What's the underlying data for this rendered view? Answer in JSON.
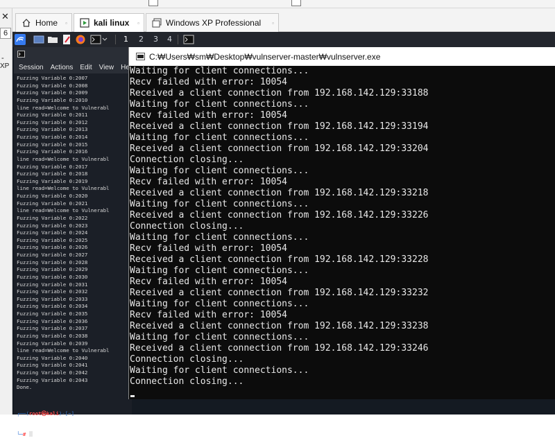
{
  "host": {
    "close_glyph": "✕",
    "field_value": "6",
    "dash": "-",
    "side_label": "XP"
  },
  "tabs": [
    {
      "label": "Home",
      "icon": "home-icon"
    },
    {
      "label": "kali linux",
      "icon": "vm-play-icon"
    },
    {
      "label": "Windows XP Professional",
      "icon": "vm-icon"
    }
  ],
  "kali_panel": {
    "workspaces": [
      "1",
      "2",
      "3",
      "4"
    ],
    "accent": "#367bf0"
  },
  "kali_terminal": {
    "menu": [
      "Session",
      "Actions",
      "Edit",
      "View",
      "He"
    ],
    "lines": [
      "Fuzzing Variable 0:2007",
      "Fuzzing Variable 0:2008",
      "Fuzzing Variable 0:2009",
      "Fuzzing Variable 0:2010",
      "line read=Welcome to Vulnerabl",
      "Fuzzing Variable 0:2011",
      "Fuzzing Variable 0:2012",
      "Fuzzing Variable 0:2013",
      "Fuzzing Variable 0:2014",
      "Fuzzing Variable 0:2015",
      "Fuzzing Variable 0:2016",
      "line read=Welcome to Vulnerabl",
      "Fuzzing Variable 0:2017",
      "Fuzzing Variable 0:2018",
      "Fuzzing Variable 0:2019",
      "line read=Welcome to Vulnerabl",
      "Fuzzing Variable 0:2020",
      "Fuzzing Variable 0:2021",
      "line read=Welcome to Vulnerabl",
      "Fuzzing Variable 0:2022",
      "Fuzzing Variable 0:2023",
      "Fuzzing Variable 0:2024",
      "Fuzzing Variable 0:2025",
      "Fuzzing Variable 0:2026",
      "Fuzzing Variable 0:2027",
      "Fuzzing Variable 0:2028",
      "Fuzzing Variable 0:2029",
      "Fuzzing Variable 0:2030",
      "Fuzzing Variable 0:2031",
      "Fuzzing Variable 0:2032",
      "Fuzzing Variable 0:2033",
      "Fuzzing Variable 0:2034",
      "Fuzzing Variable 0:2035",
      "Fuzzing Variable 0:2036",
      "Fuzzing Variable 0:2037",
      "Fuzzing Variable 0:2038",
      "Fuzzing Variable 0:2039",
      "line read=Welcome to Vulnerabl",
      "Fuzzing Variable 0:2040",
      "Fuzzing Variable 0:2041",
      "Fuzzing Variable 0:2042",
      "Fuzzing Variable 0:2043",
      "Done."
    ],
    "prompt_open": "┌──(",
    "prompt_user": "root㉿kali",
    "prompt_close": ")-[~]",
    "prompt_line2": "└─",
    "prompt_symbol": "#"
  },
  "cmd_window": {
    "title": "C:₩Users₩sm₩Desktop₩vulnserver-master₩vulnserver.exe",
    "lines": [
      "Waiting for client connections...",
      "Recv failed with error: 10054",
      "Received a client connection from 192.168.142.129:33188",
      "Waiting for client connections...",
      "Recv failed with error: 10054",
      "Received a client connection from 192.168.142.129:33194",
      "Waiting for client connections...",
      "Received a client connection from 192.168.142.129:33204",
      "Connection closing...",
      "Waiting for client connections...",
      "Recv failed with error: 10054",
      "Received a client connection from 192.168.142.129:33218",
      "Waiting for client connections...",
      "Received a client connection from 192.168.142.129:33226",
      "Connection closing...",
      "Waiting for client connections...",
      "Recv failed with error: 10054",
      "Received a client connection from 192.168.142.129:33228",
      "Waiting for client connections...",
      "Recv failed with error: 10054",
      "Received a client connection from 192.168.142.129:33232",
      "Waiting for client connections...",
      "Recv failed with error: 10054",
      "Received a client connection from 192.168.142.129:33238",
      "Waiting for client connections...",
      "Received a client connection from 192.168.142.129:33246",
      "Connection closing...",
      "Waiting for client connections...",
      "Connection closing..."
    ]
  }
}
